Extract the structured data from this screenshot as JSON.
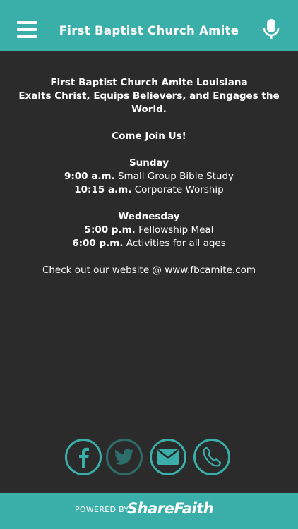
{
  "header": {
    "title": "First Baptist Church Amite",
    "menu_icon": "hamburger-menu-icon",
    "mic_icon": "microphone-icon",
    "color": "#3aafa9"
  },
  "content": {
    "heading_line1": "First Baptist Church Amite Louisiana",
    "heading_line2": "Exalts Christ, Equips Believers, and Engages the World.",
    "come_join": "Come Join Us!",
    "sunday": {
      "day": "Sunday",
      "items": [
        {
          "time": "9:00 a.m.",
          "desc": "Small Group Bible Study"
        },
        {
          "time": "10:15 a.m.",
          "desc": "Corporate Worship"
        }
      ]
    },
    "wednesday": {
      "day": "Wednesday",
      "items": [
        {
          "time": "5:00 p.m.",
          "desc": "Fellowship Meal"
        },
        {
          "time": "6:00 p.m.",
          "desc": "Activities for all ages"
        }
      ]
    },
    "website": "Check out our website @ www.fbcamite.com"
  },
  "social": [
    {
      "icon": "facebook-icon"
    },
    {
      "icon": "twitter-icon"
    },
    {
      "icon": "email-icon"
    },
    {
      "icon": "phone-icon"
    }
  ],
  "footer": {
    "powered_by": "POWERED BY",
    "brand": "ShareFaith"
  }
}
